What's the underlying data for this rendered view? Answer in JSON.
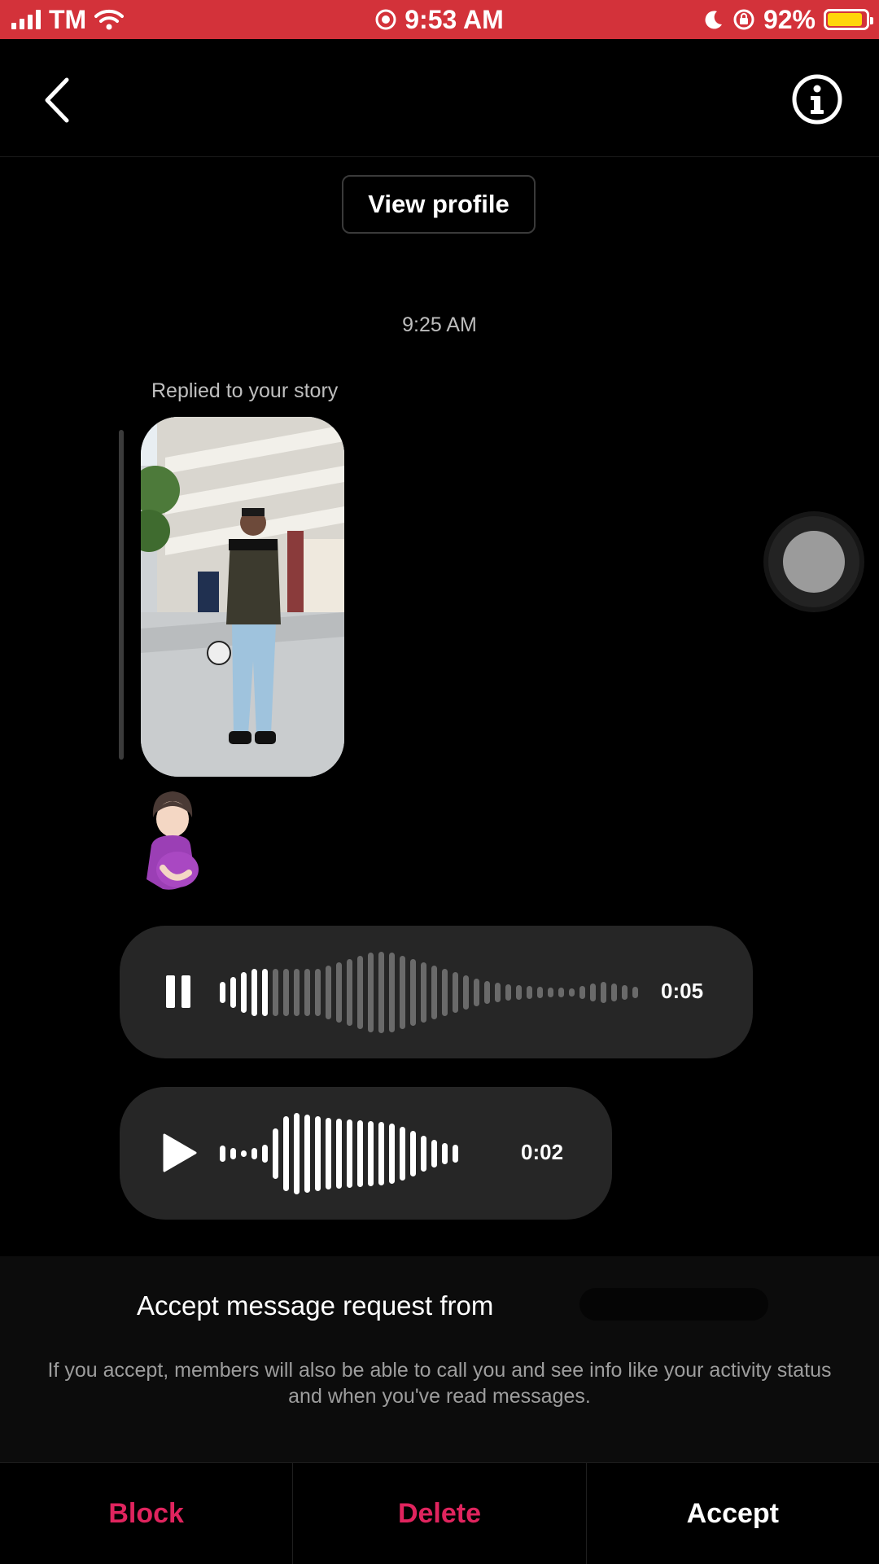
{
  "status_bar": {
    "carrier": "TM",
    "time": "9:53 AM",
    "battery_percent": "92%",
    "battery_level": 0.92,
    "background_color": "#d3323a",
    "battery_fill_color": "#ffd60a"
  },
  "header": {
    "back_icon": "chevron-left-icon",
    "info_icon": "info-circle-icon"
  },
  "view_profile_label": "View profile",
  "timestamp": "9:25 AM",
  "replied_label": "Replied to your story",
  "reaction_emoji": "🤰",
  "voice_messages": [
    {
      "state": "playing",
      "control_icon": "pause-icon",
      "duration": "0:05",
      "played_fraction": 0.12
    },
    {
      "state": "paused",
      "control_icon": "play-icon",
      "duration": "0:02",
      "played_fraction": 1.0
    }
  ],
  "request": {
    "title": "Accept message request from",
    "description": "If you accept, members will also be able to call you and see info like your activity status and when you've read messages."
  },
  "actions": {
    "block": "Block",
    "delete": "Delete",
    "accept": "Accept",
    "destructive_color": "#e0245e"
  }
}
